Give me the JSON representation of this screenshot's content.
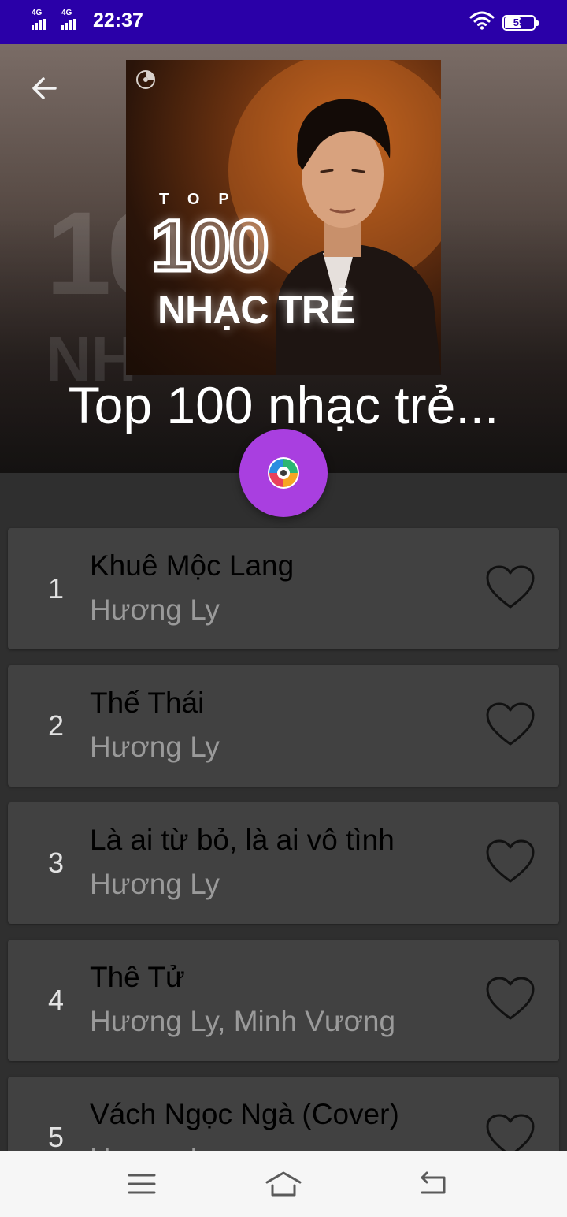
{
  "status_bar": {
    "network_1": "4G",
    "network_2": "4G",
    "time": "22:37",
    "battery_level": "59",
    "battery_fraction": 0.59
  },
  "header": {
    "background_text_line1": "10",
    "background_text_line2": "NH",
    "cover": {
      "top_label": "TOP",
      "number_label": "100",
      "genre_label": "NHẠC TRẺ"
    },
    "title": "Top 100 nhạc trẻ..."
  },
  "songs": [
    {
      "rank": "1",
      "title": "Khuê Mộc Lang",
      "artist": "Hương Ly"
    },
    {
      "rank": "2",
      "title": "Thế Thái",
      "artist": "Hương Ly"
    },
    {
      "rank": "3",
      "title": "Là ai từ bỏ, là ai vô tình",
      "artist": "Hương Ly"
    },
    {
      "rank": "4",
      "title": "Thê Tử",
      "artist": "Hương Ly, Minh Vương"
    },
    {
      "rank": "5",
      "title": "Vách Ngọc Ngà (Cover)",
      "artist": "Hương Ly"
    }
  ],
  "icons": {
    "back": "arrow-left-icon",
    "play": "color-disc-icon",
    "favorite": "heart-outline-icon",
    "nav_menu": "menu-icon",
    "nav_home": "home-icon",
    "nav_back": "back-icon"
  },
  "colors": {
    "status_bar": "#2a00a8",
    "play_button": "#a93fe0",
    "card": "#414141",
    "background": "#2f2f2f",
    "nav_bar": "#f6f6f6"
  }
}
